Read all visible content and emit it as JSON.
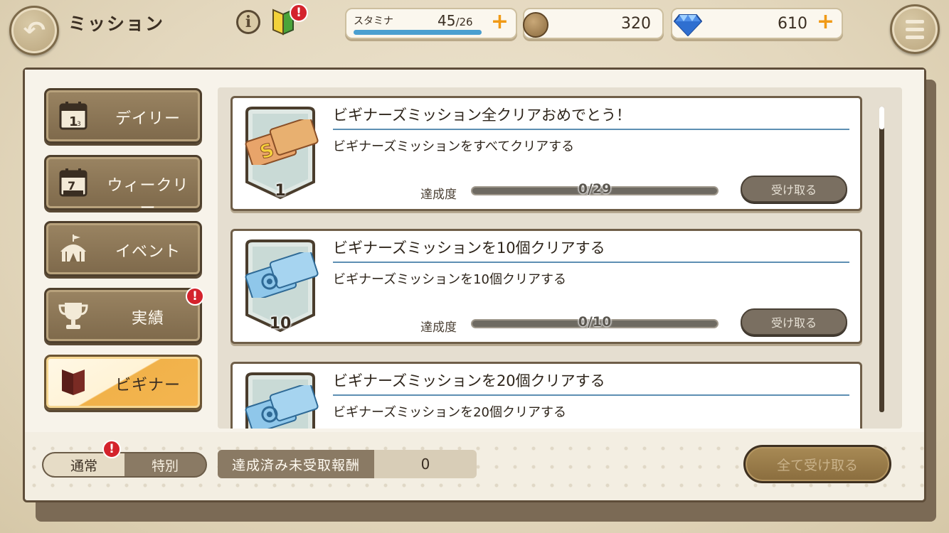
{
  "header": {
    "title": "ミッション",
    "info_symbol": "i",
    "alert_symbol": "!",
    "stamina": {
      "label": "スタミナ",
      "current": "45",
      "max": "/26",
      "fill_fraction": 1.0
    },
    "coins": "320",
    "gems": "610",
    "plus_symbol": "+"
  },
  "sidebar": {
    "tabs": [
      {
        "label": "デイリー",
        "icon": "calendar-1-icon",
        "active": false
      },
      {
        "label": "ウィークリー",
        "icon": "calendar-7-days-icon",
        "active": false
      },
      {
        "label": "イベント",
        "icon": "tent-icon",
        "active": false
      },
      {
        "label": "実績",
        "icon": "trophy-icon",
        "active": false,
        "alert": true
      },
      {
        "label": "ビギナー",
        "icon": "beginner-mark-icon",
        "active": true
      }
    ]
  },
  "missions": [
    {
      "title": "ビギナーズミッション全クリアおめでとう！",
      "description": "ビギナーズミッションをすべてクリアする",
      "progress_label": "達成度",
      "progress_text": "0/29",
      "progress_fraction": 0,
      "claim_label": "受け取る",
      "reward_qty": "1",
      "reward_icon": "gold-ticket-icon"
    },
    {
      "title": "ビギナーズミッションを10個クリアする",
      "description": "ビギナーズミッションを10個クリアする",
      "progress_label": "達成度",
      "progress_text": "0/10",
      "progress_fraction": 0,
      "claim_label": "受け取る",
      "reward_qty": "10",
      "reward_icon": "blue-ticket-icon"
    },
    {
      "title": "ビギナーズミッションを20個クリアする",
      "description": "ビギナーズミッションを20個クリアする",
      "reward_icon": "blue-ticket-icon"
    }
  ],
  "footer": {
    "mode_normal": "通常",
    "mode_special": "特別",
    "unclaimed_label": "達成済み未受取報酬",
    "unclaimed_value": "0",
    "claim_all_label": "全て受け取る"
  },
  "colors": {
    "accent_orange": "#f09a16",
    "alert_red": "#d4232c",
    "rule_blue": "#5d8fb3",
    "active_tab": "#f4b550"
  }
}
